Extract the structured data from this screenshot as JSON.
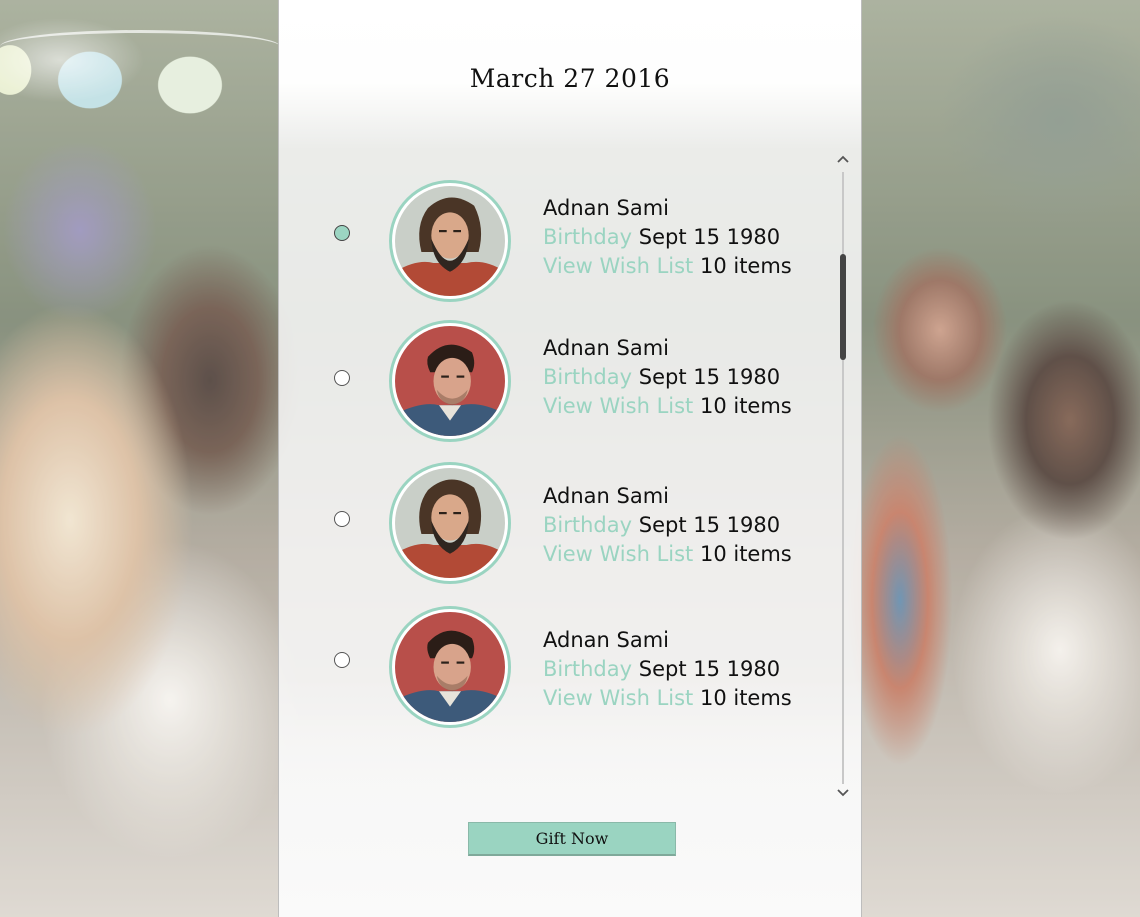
{
  "header": {
    "date": "March 27 2016"
  },
  "contacts": [
    {
      "name": "Adnan Sami",
      "birthday_label": "Birthday",
      "birthday": "Sept 15 1980",
      "wishlist_label": "View Wish List",
      "wishlist_count": "10 items",
      "selected": true,
      "avatar": "bearded-man"
    },
    {
      "name": "Adnan Sami",
      "birthday_label": "Birthday",
      "birthday": "Sept 15 1980",
      "wishlist_label": "View Wish List",
      "wishlist_count": "10 items",
      "selected": false,
      "avatar": "dark-haired-man"
    },
    {
      "name": "Adnan Sami",
      "birthday_label": "Birthday",
      "birthday": "Sept 15 1980",
      "wishlist_label": "View Wish List",
      "wishlist_count": "10 items",
      "selected": false,
      "avatar": "bearded-man"
    },
    {
      "name": "Adnan Sami",
      "birthday_label": "Birthday",
      "birthday": "Sept 15 1980",
      "wishlist_label": "View Wish List",
      "wishlist_count": "10 items",
      "selected": false,
      "avatar": "dark-haired-man"
    }
  ],
  "scrollbar": {
    "up_icon": "chevron-up-icon",
    "down_icon": "chevron-down-icon"
  },
  "actions": {
    "gift_now_label": "Gift Now"
  },
  "colors": {
    "accent": "#9ad4c1",
    "text": "#111111"
  }
}
